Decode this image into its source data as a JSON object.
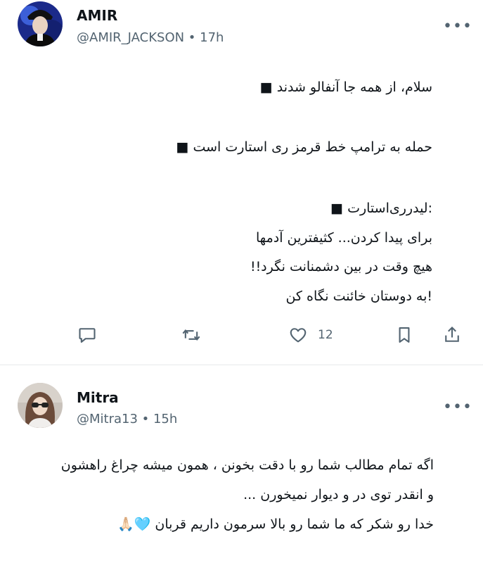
{
  "posts": [
    {
      "author_name": "AMIR",
      "handle_meta": "@AMIR_JACKSON • 17h",
      "avatar": "avatar-photo",
      "lines": [
        "سلام، از همه جا آنفالو شدند ■",
        "حمله به ترامپ خط قرمز ری استارت است ■",
        ":لیدرری‌استارت ■",
        "برای پیدا کردن... کثیفترین آدمها",
        "هیچ وقت در بین دشمنانت نگرد!!",
        "!به دوستان خائنت نگاه کن"
      ],
      "actions": {
        "reply_icon": "speech-bubble-icon",
        "repost_icon": "repost-arrows-icon",
        "like_icon": "heart-icon",
        "like_count": "12",
        "bookmark_icon": "bookmark-icon",
        "share_icon": "share-upload-icon"
      },
      "more_icon": "more-dots-icon",
      "more_label": "•••"
    },
    {
      "author_name": "Mitra",
      "handle_meta": "@Mitra13 • 15h",
      "avatar": "avatar-photo",
      "lines": [
        "اگه تمام مطالب شما رو با دقت بخونن ، همون میشه چراغ راهشون",
        "و انقدر توی در و دیوار نمیخورن ...",
        "خدا رو شکر که ما شما رو بالا سرمون داریم قربان 🩵🙏🏻"
      ],
      "more_icon": "more-dots-icon",
      "more_label": "•••"
    }
  ],
  "colors": {
    "text": "#0f1419",
    "secondary": "#536471",
    "divider": "#e7e9ea"
  }
}
